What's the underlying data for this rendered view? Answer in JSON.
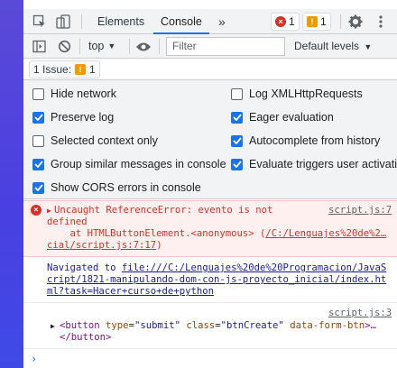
{
  "tabs": {
    "elements": "Elements",
    "console": "Console",
    "more": "»"
  },
  "badges": {
    "errors": "1",
    "warnings": "1"
  },
  "toolbar": {
    "context": "top",
    "filter_placeholder": "Filter",
    "levels": "Default levels"
  },
  "issues": {
    "label": "1 Issue:",
    "count": "1"
  },
  "settings": {
    "left": [
      {
        "label": "Hide network",
        "checked": false
      },
      {
        "label": "Preserve log",
        "checked": true
      },
      {
        "label": "Selected context only",
        "checked": false
      },
      {
        "label": "Group similar messages in console",
        "checked": true
      },
      {
        "label": "Show CORS errors in console",
        "checked": true
      }
    ],
    "right": [
      {
        "label": "Log XMLHttpRequests",
        "checked": false
      },
      {
        "label": "Eager evaluation",
        "checked": true
      },
      {
        "label": "Autocomplete from history",
        "checked": true
      },
      {
        "label": "Evaluate triggers user activation",
        "checked": true
      }
    ]
  },
  "console": {
    "error": {
      "line1": "Uncaught ReferenceError: evento is not",
      "line2": "defined",
      "line3_prefix": "    at HTMLButtonElement.<anonymous> (",
      "line3_link": "/C:/Lenguajes%20de%2…",
      "line4": "cial/script.js:7:17",
      "line4_suffix": ")",
      "source": "script.js:7"
    },
    "navigation": {
      "prefix": "Navigated to ",
      "line1": "file:///C:/Lenguajes%20de%20Programacion/JavaS",
      "line2": "cript/1821-manipulando-dom-con-js-proyecto_inicial/index.ht",
      "line3": "ml?task=Hacer+curso+de+python"
    },
    "element": {
      "source": "script.js:3",
      "open_tag": "<button",
      "a1": "type",
      "v1": "\"submit\"",
      "a2": "class",
      "v2": "\"btnCreate\"",
      "a3": "data-form-btn",
      "tail": ">…",
      "close_tag": "</button>"
    },
    "prompt": "›"
  }
}
